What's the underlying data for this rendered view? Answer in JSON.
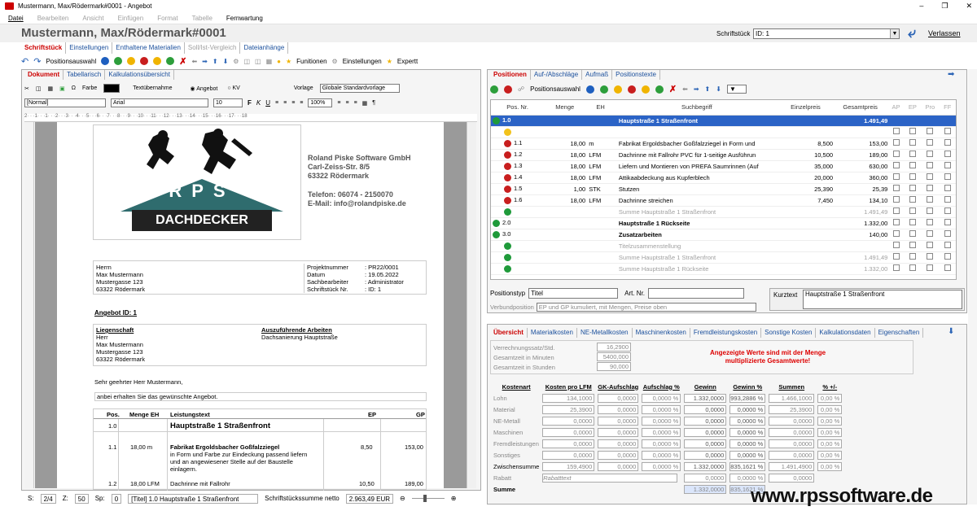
{
  "window": {
    "title": "Mustermann, Max/Rödermark#0001 - Angebot"
  },
  "menu": {
    "items": [
      {
        "label": "Datei",
        "disabled": false
      },
      {
        "label": "Bearbeiten",
        "disabled": true
      },
      {
        "label": "Ansicht",
        "disabled": true
      },
      {
        "label": "Einfügen",
        "disabled": true
      },
      {
        "label": "Format",
        "disabled": true
      },
      {
        "label": "Tabelle",
        "disabled": true
      },
      {
        "label": "Fernwartung",
        "disabled": false
      }
    ]
  },
  "header": {
    "title": "Mustermann, Max/Rödermark#0001",
    "doc_label": "Schriftstück",
    "doc_value": "ID: 1",
    "exit_label": "Verlassen"
  },
  "top_tabs": [
    {
      "label": "Schriftstück",
      "state": "active"
    },
    {
      "label": "Einstellungen",
      "state": "normal"
    },
    {
      "label": "Enthaltene Materialien",
      "state": "normal"
    },
    {
      "label": "Soll/Ist-Vergleich",
      "state": "disabled"
    },
    {
      "label": "Dateianhänge",
      "state": "normal"
    }
  ],
  "toolbar": {
    "positionsauswahl": "Positionsauswahl",
    "funktionen": "Funitionen",
    "einstellungen": "Einstellungen",
    "expert": "Expertt"
  },
  "left": {
    "tabs": [
      "Dokument",
      "Tabellarisch",
      "Kalkulationsübersicht"
    ],
    "farbe": "Farbe",
    "textuebernahme": "Textübernahme",
    "radio_angebot": "Angebot",
    "radio_kv": "KV",
    "vorlage_label": "Vorlage",
    "vorlage_value": "Globale Standardvorlage",
    "style": "[Normal]",
    "font": "Arial",
    "size": "10",
    "zoom": "100%",
    "ruler": "2· · ·1· · ·1· · ·2· · ·3· · ·4· · ·5· · ·6· · ·7· · ·8· · ·9· · ·10· · ·11· · ·12· · ·13· · ·14· · ·15· · ·16· · ·17· · ·18"
  },
  "letter": {
    "logo_text": "RPS",
    "logo_sub": "DACHDECKER",
    "company": [
      "Roland Piske Software GmbH",
      "Carl-Zeiss-Str. 8/5",
      "63322 Rödermark"
    ],
    "contact": [
      "Telefon: 06074 - 2150070",
      "E-Mail: info@rolandpiske.de"
    ],
    "recipient": [
      "Herrn",
      "Max Mustermann",
      "Mustergasse 123",
      "63322 Rödermark"
    ],
    "meta_labels": [
      "Projektnummer",
      "Datum",
      "Sachbearbeiter",
      "Schriftstück Nr."
    ],
    "meta_values": [
      ": PR22/0001",
      ": 19.05.2022",
      ": Administrator",
      ": ID: 1"
    ],
    "angebot_title": "Angebot ID: 1",
    "liegenschaft_label": "Liegenschaft",
    "liegenschaft": [
      "Herr",
      "Max Mustermann",
      "Mustergasse 123",
      "63322 Rödermark"
    ],
    "arbeiten_label": "Auszuführende Arbeiten",
    "arbeiten": "Dachsanierung Hauptstraße",
    "salutation": "Sehr geehrter Herr Mustermann,",
    "intro": "anbei erhalten Sie das gewünschte Angebot.",
    "table_head": [
      "Pos.",
      "Menge EH",
      "Leistungstext",
      "EP",
      "GP"
    ],
    "row_title_pos": "1.0",
    "row_title_text": "Hauptstraße 1 Straßenfront",
    "row1_pos": "1.1",
    "row1_menge": "18,00 m",
    "row1_title": "Fabrikat Ergoldsbacher Goßfalzziegel",
    "row1_text": [
      "in Form und Farbe zur Eindeckung passend liefern",
      "und an angewiesener Stelle auf der Baustelle",
      "einlagern."
    ],
    "row1_ep": "8,50",
    "row1_gp": "153,00",
    "row2_pos": "1.2",
    "row2_menge": "18,00 LFM",
    "row2_text": "Dachrinne mit Fallrohr",
    "row2_ep": "10,50",
    "row2_gp": "189,00"
  },
  "status": {
    "s_label": "S:",
    "s_val": "2/4",
    "z_label": "Z:",
    "z_val": "50",
    "sp_label": "Sp:",
    "sp_val": "0",
    "title": "[Titel]  1.0 Hauptstraße 1 Straßenfront",
    "sum_label": "Schriftstückssumme netto",
    "sum_value": "2.963,49 EUR"
  },
  "positions": {
    "tabs": [
      "Positionen",
      "Auf-/Abschläge",
      "Aufmaß",
      "Positionstexte"
    ],
    "toolbar_label": "Positionsauswahl",
    "columns": [
      "Pos. Nr.",
      "Menge",
      "EH",
      "Suchbegriff",
      "Einzelpreis",
      "Gesamtpreis",
      "AP",
      "EP",
      "Pro",
      "FF"
    ],
    "rows": [
      {
        "pos": "1.0",
        "menge": "",
        "eh": "",
        "text": "Hauptstraße 1 Straßenfront",
        "ep": "",
        "gp": "1.491,49",
        "dot": "g",
        "kind": "sel"
      },
      {
        "pos": "",
        "menge": "",
        "eh": "",
        "text": "",
        "ep": "",
        "gp": "",
        "dot": "y",
        "kind": "normal"
      },
      {
        "pos": "1.1",
        "menge": "18,00",
        "eh": "m",
        "text": "Fabrikat Ergoldsbacher Goßfalzziegel in Form und",
        "ep": "8,500",
        "gp": "153,00",
        "dot": "r",
        "kind": "normal"
      },
      {
        "pos": "1.2",
        "menge": "18,00",
        "eh": "LFM",
        "text": "Dachrinne mit Fallrohr PVC für 1-seitige Ausführun",
        "ep": "10,500",
        "gp": "189,00",
        "dot": "r",
        "kind": "normal"
      },
      {
        "pos": "1.3",
        "menge": "18,00",
        "eh": "LFM",
        "text": "Liefern und Montieren von PREFA Saumrinnen (Auf",
        "ep": "35,000",
        "gp": "630,00",
        "dot": "r",
        "kind": "normal"
      },
      {
        "pos": "1.4",
        "menge": "18,00",
        "eh": "LFM",
        "text": "Attikaabdeckung aus Kupferblech",
        "ep": "20,000",
        "gp": "360,00",
        "dot": "r",
        "kind": "normal"
      },
      {
        "pos": "1.5",
        "menge": "1,00",
        "eh": "STK",
        "text": "Stutzen",
        "ep": "25,390",
        "gp": "25,39",
        "dot": "r",
        "kind": "normal"
      },
      {
        "pos": "1.6",
        "menge": "18,00",
        "eh": "LFM",
        "text": "Dachrinne streichen",
        "ep": "7,450",
        "gp": "134,10",
        "dot": "r",
        "kind": "normal"
      },
      {
        "pos": "",
        "menge": "",
        "eh": "",
        "text": "Summe Hauptstraße 1 Straßenfront",
        "ep": "",
        "gp": "1.491,49",
        "dot": "g",
        "kind": "gray"
      },
      {
        "pos": "2.0",
        "menge": "",
        "eh": "",
        "text": "Hauptstraße 1 Rückseite",
        "ep": "",
        "gp": "1.332,00",
        "dot": "g",
        "kind": "bold"
      },
      {
        "pos": "3.0",
        "menge": "",
        "eh": "",
        "text": "Zusatzarbeiten",
        "ep": "",
        "gp": "140,00",
        "dot": "g",
        "kind": "bold"
      },
      {
        "pos": "",
        "menge": "",
        "eh": "",
        "text": "Titelzusammenstellung",
        "ep": "",
        "gp": "",
        "dot": "g",
        "kind": "gray"
      },
      {
        "pos": "",
        "menge": "",
        "eh": "",
        "text": "Summe Hauptstraße 1 Straßenfront",
        "ep": "",
        "gp": "1.491,49",
        "dot": "g",
        "kind": "gray"
      },
      {
        "pos": "",
        "menge": "",
        "eh": "",
        "text": "Summe Hauptstraße 1 Rückseite",
        "ep": "",
        "gp": "1.332,00",
        "dot": "g",
        "kind": "gray"
      }
    ],
    "postyp_label": "Positionstyp",
    "postyp_value": "Titel",
    "artnr_label": "Art. Nr.",
    "kurztext_label": "Kurztext",
    "kurztext_value": "Hauptstraße 1 Straßenfront",
    "verbund_label": "Verbundposition",
    "verbund_value": "EP und GP kumuliert, mit Mengen, Preise oben"
  },
  "bottom": {
    "tabs": [
      "Übersicht",
      "Materialkosten",
      "NE-Metallkosten",
      "Maschinenkosten",
      "Fremdleistungskosten",
      "Sonstige Kosten",
      "Kalkulationsdaten",
      "Eigenschaften"
    ],
    "verrechnung_label": "Verrechnungssatz/Std.",
    "verrechnung_value": "16,2900",
    "minuten_label": "Gesamtzeit in Minuten",
    "minuten_value": "5400,000",
    "stunden_label": "Gesamtzeit in Stunden",
    "stunden_value": "90,000",
    "warning": [
      "Angezeigte Werte sind mit der Menge",
      "multiplizierte Gesamtwerte!"
    ],
    "cost_headers": [
      "Kostenart",
      "Kosten pro LFM",
      "GK-Aufschlag",
      "Aufschlag %",
      "Gewinn",
      "Gewinn %",
      "Summen",
      "% +/-"
    ],
    "cost_rows": [
      {
        "name": "Lohn",
        "k": "134,1000",
        "gk": "0,0000",
        "a": "0,0000 %",
        "g": "1.332,0000",
        "gp": "993,2886 %",
        "s": "1.466,1000",
        "pm": "0,00 %"
      },
      {
        "name": "Material",
        "k": "25,3900",
        "gk": "0,0000",
        "a": "0,0000 %",
        "g": "0,0000",
        "gp": "0,0000 %",
        "s": "25,3900",
        "pm": "0,00 %"
      },
      {
        "name": "NE-Metall",
        "k": "0,0000",
        "gk": "0,0000",
        "a": "0,0000 %",
        "g": "0,0000",
        "gp": "0,0000 %",
        "s": "0,0000",
        "pm": "0,00 %"
      },
      {
        "name": "Maschinen",
        "k": "0,0000",
        "gk": "0,0000",
        "a": "0,0000 %",
        "g": "0,0000",
        "gp": "0,0000 %",
        "s": "0,0000",
        "pm": "0,00 %"
      },
      {
        "name": "Fremdleistungen",
        "k": "0,0000",
        "gk": "0,0000",
        "a": "0,0000 %",
        "g": "0,0000",
        "gp": "0,0000 %",
        "s": "0,0000",
        "pm": "0,00 %"
      },
      {
        "name": "Sonstiges",
        "k": "0,0000",
        "gk": "0,0000",
        "a": "0,0000 %",
        "g": "0,0000",
        "gp": "0,0000 %",
        "s": "0,0000",
        "pm": "0,00 %"
      }
    ],
    "zwischen": {
      "name": "Zwischensumme",
      "k": "159,4900",
      "gk": "0,0000",
      "a": "0,0000 %",
      "g": "1.332,0000",
      "gp": "835,1621 %",
      "s": "1.491,4900",
      "pm": "0,00 %"
    },
    "rabatt_label": "Rabatt",
    "rabatt_text": "Rabatttext",
    "rabatt_g": "0,0000",
    "rabatt_gp": "0,0000 %",
    "rabatt_s": "0,0000",
    "summe_label": "Summe",
    "summe_g": "1.332,0000",
    "summe_gp": "835,1621 %"
  },
  "watermark": "www.rpssoftware.de",
  "colors": {
    "accent": "#c00000",
    "link": "#1a4f9c",
    "selection": "#2b63c6"
  }
}
